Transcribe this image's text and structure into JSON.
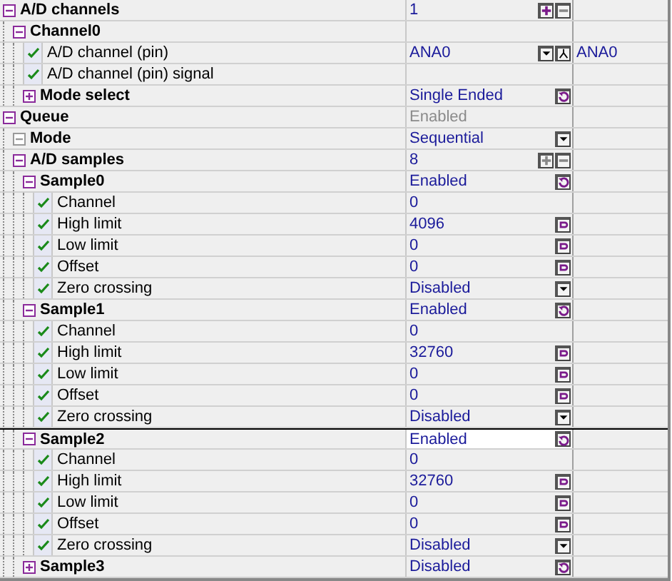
{
  "tree": [
    {
      "label": "A/D channels",
      "kind": "group",
      "expanded": true,
      "selected": false,
      "value": "1",
      "value_disabled": false,
      "control": {
        "kind": "spin"
      },
      "children": [
        {
          "label": "Channel0",
          "kind": "group",
          "expanded": true,
          "selected": false,
          "children": [
            {
              "label": "A/D channel (pin)",
              "kind": "property",
              "selected": false,
              "value": "ANA0",
              "value_disabled": false,
              "control": {
                "kind": "pin"
              },
              "extra": "ANA0"
            },
            {
              "label": "A/D channel (pin) signal",
              "kind": "property",
              "selected": false
            },
            {
              "label": "Mode select",
              "kind": "group",
              "expanded": false,
              "selected": false,
              "value": "Single Ended",
              "value_disabled": false,
              "control": {
                "kind": "reset"
              }
            }
          ]
        }
      ]
    },
    {
      "label": "Queue",
      "kind": "group",
      "expanded": true,
      "selected": false,
      "value": "Enabled",
      "value_disabled": true,
      "children": [
        {
          "label": "Mode",
          "kind": "group",
          "expanded": true,
          "disabled": true,
          "selected": false,
          "value": "Sequential",
          "value_disabled": false,
          "control": {
            "kind": "dropdown"
          }
        },
        {
          "label": "A/D samples",
          "kind": "group",
          "expanded": true,
          "selected": false,
          "value": "8",
          "value_disabled": false,
          "control": {
            "kind": "spin_off"
          },
          "children": [
            {
              "label": "Sample0",
              "kind": "group",
              "expanded": true,
              "selected": false,
              "value": "Enabled",
              "value_disabled": false,
              "control": {
                "kind": "reset"
              },
              "children": [
                {
                  "label": "Channel",
                  "kind": "property",
                  "selected": false,
                  "value": "0",
                  "value_disabled": false
                },
                {
                  "label": "High limit",
                  "kind": "property",
                  "selected": false,
                  "value": "4096",
                  "value_disabled": false,
                  "control": {
                    "kind": "edit"
                  }
                },
                {
                  "label": "Low limit",
                  "kind": "property",
                  "selected": false,
                  "value": "0",
                  "value_disabled": false,
                  "control": {
                    "kind": "edit"
                  }
                },
                {
                  "label": "Offset",
                  "kind": "property",
                  "selected": false,
                  "value": "0",
                  "value_disabled": false,
                  "control": {
                    "kind": "edit"
                  }
                },
                {
                  "label": "Zero crossing",
                  "kind": "property",
                  "selected": false,
                  "value": "Disabled",
                  "value_disabled": false,
                  "control": {
                    "kind": "dropdown"
                  }
                }
              ]
            },
            {
              "label": "Sample1",
              "kind": "group",
              "expanded": true,
              "selected": false,
              "value": "Enabled",
              "value_disabled": false,
              "control": {
                "kind": "reset"
              },
              "children": [
                {
                  "label": "Channel",
                  "kind": "property",
                  "selected": false,
                  "value": "0",
                  "value_disabled": false
                },
                {
                  "label": "High limit",
                  "kind": "property",
                  "selected": false,
                  "value": "32760",
                  "value_disabled": false,
                  "control": {
                    "kind": "edit"
                  }
                },
                {
                  "label": "Low limit",
                  "kind": "property",
                  "selected": false,
                  "value": "0",
                  "value_disabled": false,
                  "control": {
                    "kind": "edit"
                  }
                },
                {
                  "label": "Offset",
                  "kind": "property",
                  "selected": false,
                  "value": "0",
                  "value_disabled": false,
                  "control": {
                    "kind": "edit"
                  }
                },
                {
                  "label": "Zero crossing",
                  "kind": "property",
                  "selected": false,
                  "value": "Disabled",
                  "value_disabled": false,
                  "control": {
                    "kind": "dropdown"
                  }
                }
              ]
            },
            {
              "label": "Sample2",
              "kind": "group",
              "expanded": true,
              "selected": true,
              "value": "Enabled",
              "value_disabled": false,
              "control": {
                "kind": "reset"
              },
              "children": [
                {
                  "label": "Channel",
                  "kind": "property",
                  "selected": false,
                  "value": "0",
                  "value_disabled": false
                },
                {
                  "label": "High limit",
                  "kind": "property",
                  "selected": false,
                  "value": "32760",
                  "value_disabled": false,
                  "control": {
                    "kind": "edit"
                  }
                },
                {
                  "label": "Low limit",
                  "kind": "property",
                  "selected": false,
                  "value": "0",
                  "value_disabled": false,
                  "control": {
                    "kind": "edit"
                  }
                },
                {
                  "label": "Offset",
                  "kind": "property",
                  "selected": false,
                  "value": "0",
                  "value_disabled": false,
                  "control": {
                    "kind": "edit"
                  }
                },
                {
                  "label": "Zero crossing",
                  "kind": "property",
                  "selected": false,
                  "value": "Disabled",
                  "value_disabled": false,
                  "control": {
                    "kind": "dropdown"
                  }
                }
              ]
            },
            {
              "label": "Sample3",
              "kind": "group",
              "expanded": false,
              "selected": false,
              "value": "Disabled",
              "value_disabled": false,
              "control": {
                "kind": "reset"
              }
            }
          ]
        }
      ]
    }
  ]
}
